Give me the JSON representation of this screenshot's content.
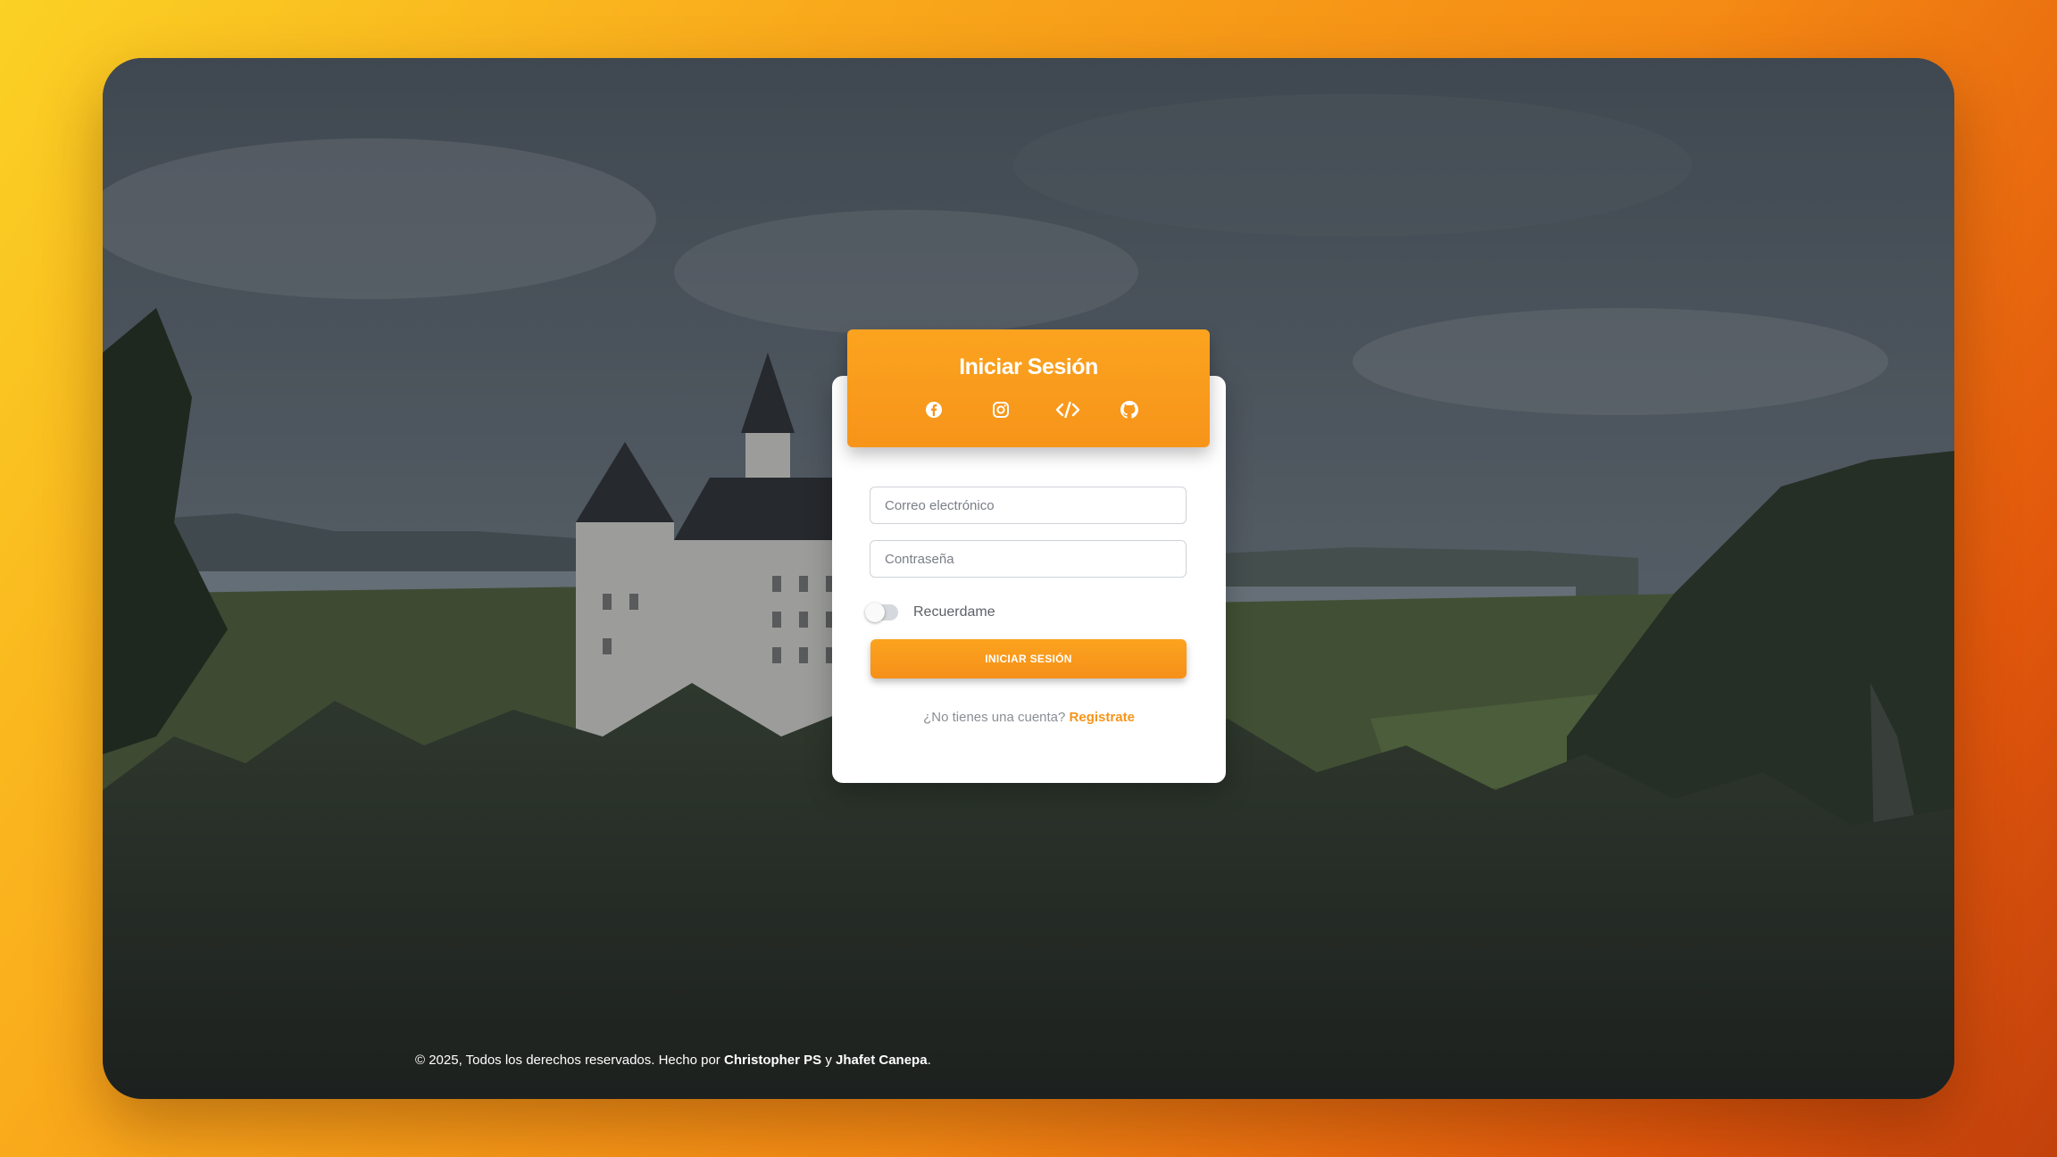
{
  "login": {
    "title": "Iniciar Sesión",
    "socials": [
      {
        "icon": "facebook-icon"
      },
      {
        "icon": "instagram-icon"
      },
      {
        "icon": "code-icon"
      },
      {
        "icon": "github-icon"
      }
    ],
    "email_placeholder": "Correo electrónico",
    "password_placeholder": "Contraseña",
    "remember_label": "Recuerdame",
    "remember_checked": false,
    "submit_label": "INICIAR SESIÓN",
    "signup_prompt": "¿No tienes una cuenta?",
    "signup_link": "Registrate"
  },
  "footer": {
    "prefix": "© 2025, Todos los derechos reservados. Hecho por",
    "author1": "Christopher PS",
    "connector": "y",
    "author2": "Jhafet Canepa",
    "suffix": "."
  },
  "colors": {
    "accent": "#f7941a",
    "gradient_start": "#fbd124",
    "gradient_end": "#c2410c"
  }
}
